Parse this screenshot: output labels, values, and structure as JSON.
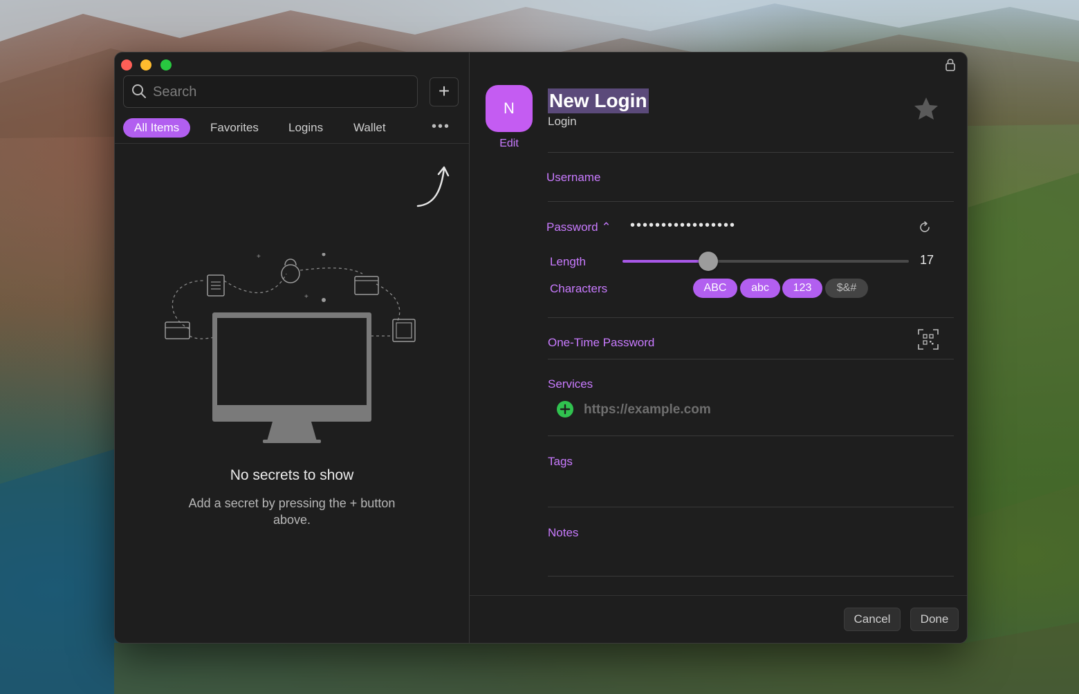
{
  "window": {
    "traffic_lights": [
      "close",
      "minimize",
      "zoom"
    ]
  },
  "sidebar": {
    "search": {
      "placeholder": "Search",
      "value": ""
    },
    "add_button_label": "+",
    "tabs": [
      {
        "label": "All Items",
        "active": true
      },
      {
        "label": "Favorites",
        "active": false
      },
      {
        "label": "Logins",
        "active": false
      },
      {
        "label": "Wallet",
        "active": false
      }
    ],
    "more_label": "•••",
    "empty_state": {
      "title": "No secrets to show",
      "subtitle": "Add a secret by pressing the + button above."
    }
  },
  "detail": {
    "avatar_letter": "N",
    "avatar_color": "#c45cf2",
    "edit_label": "Edit",
    "title": "New Login",
    "type": "Login",
    "fields": {
      "username_label": "Username",
      "password_label": "Password ⌃",
      "password_value": "•••••••••••••••••",
      "length_label": "Length",
      "length_value": "17",
      "length_fraction": 0.3,
      "characters_label": "Characters",
      "character_sets": [
        {
          "label": "ABC",
          "enabled": true
        },
        {
          "label": "abc",
          "enabled": true
        },
        {
          "label": "123",
          "enabled": true
        },
        {
          "label": "$&#",
          "enabled": false
        }
      ],
      "otp_label": "One-Time Password",
      "services_label": "Services",
      "service_placeholder": "https://example.com",
      "tags_label": "Tags",
      "notes_label": "Notes"
    },
    "footer": {
      "cancel_label": "Cancel",
      "done_label": "Done"
    },
    "accent_color": "#b25ff0"
  }
}
